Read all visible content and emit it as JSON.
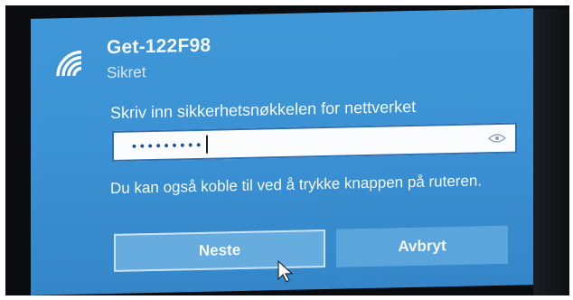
{
  "network": {
    "name": "Get-122F98",
    "status": "Sikret"
  },
  "prompt": {
    "label": "Skriv inn sikkerhetsnøkkelen for nettverket"
  },
  "password": {
    "masked_value": "•••••••••",
    "reveal_icon": "eye-icon"
  },
  "hint": {
    "text": "Du kan også koble til ved å trykke knappen på ruteren."
  },
  "buttons": {
    "next_label": "Neste",
    "cancel_label": "Avbryt"
  },
  "icons": {
    "wifi": "wifi-icon",
    "cursor": "cursor-icon"
  },
  "colors": {
    "panel_blue": "#3b92d4",
    "button_blue": "#67acdf",
    "field_border": "#2f6fb3"
  }
}
